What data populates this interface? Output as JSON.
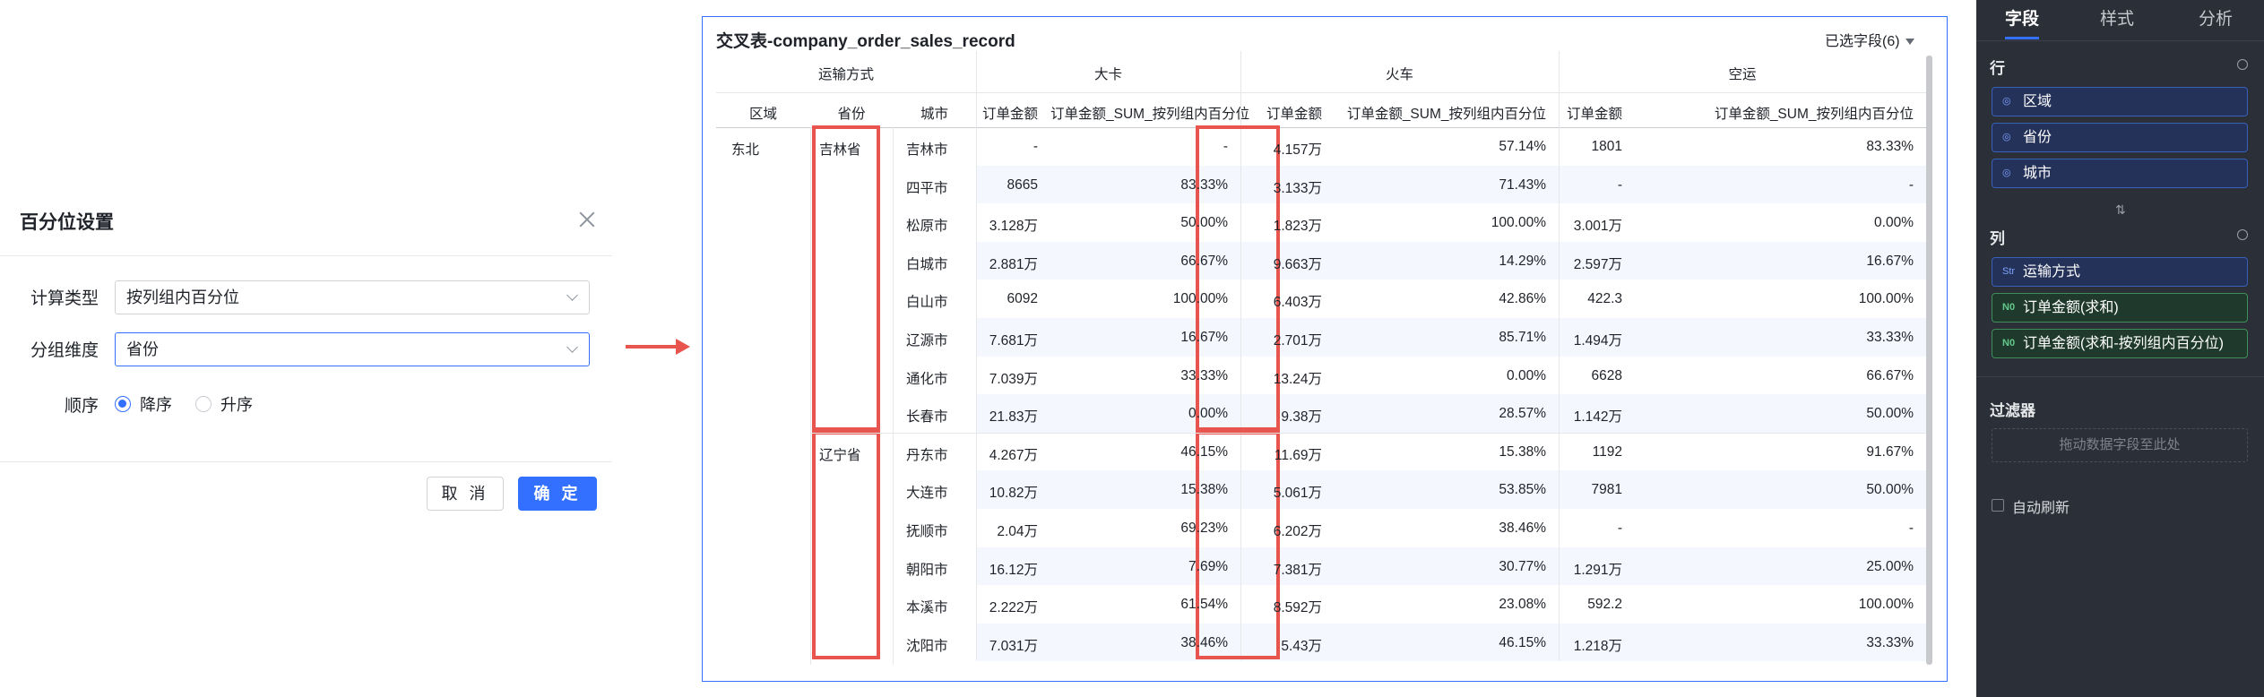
{
  "dialog": {
    "title": "百分位设置",
    "calc_type_label": "计算类型",
    "calc_type_value": "按列组内百分位",
    "group_dim_label": "分组维度",
    "group_dim_value": "省份",
    "order_label": "顺序",
    "order_desc": "降序",
    "order_asc": "升序",
    "cancel": "取 消",
    "ok": "确 定"
  },
  "table": {
    "title": "交叉表-company_order_sales_record",
    "fields_selected": "已选字段(6)",
    "col_dim_header": "运输方式",
    "groups": [
      "大卡",
      "火车",
      "空运"
    ],
    "row_headers": [
      "区域",
      "省份",
      "城市"
    ],
    "measure_a": "订单金额",
    "measure_b": "订单金额_SUM_按列组内百分位",
    "region": "东北",
    "provinces": [
      {
        "name": "吉林省",
        "rows": [
          {
            "city": "吉林市",
            "v": [
              "-",
              "-",
              "4.157万",
              "57.14%",
              "1801",
              "83.33%"
            ]
          },
          {
            "city": "四平市",
            "v": [
              "8665",
              "83.33%",
              "3.133万",
              "71.43%",
              "-",
              "-"
            ]
          },
          {
            "city": "松原市",
            "v": [
              "3.128万",
              "50.00%",
              "1.823万",
              "100.00%",
              "3.001万",
              "0.00%"
            ]
          },
          {
            "city": "白城市",
            "v": [
              "2.881万",
              "66.67%",
              "9.663万",
              "14.29%",
              "2.597万",
              "16.67%"
            ]
          },
          {
            "city": "白山市",
            "v": [
              "6092",
              "100.00%",
              "6.403万",
              "42.86%",
              "422.3",
              "100.00%"
            ]
          },
          {
            "city": "辽源市",
            "v": [
              "7.681万",
              "16.67%",
              "2.701万",
              "85.71%",
              "1.494万",
              "33.33%"
            ]
          },
          {
            "city": "通化市",
            "v": [
              "7.039万",
              "33.33%",
              "13.24万",
              "0.00%",
              "6628",
              "66.67%"
            ]
          },
          {
            "city": "长春市",
            "v": [
              "21.83万",
              "0.00%",
              "9.38万",
              "28.57%",
              "1.142万",
              "50.00%"
            ]
          }
        ]
      },
      {
        "name": "辽宁省",
        "rows": [
          {
            "city": "丹东市",
            "v": [
              "4.267万",
              "46.15%",
              "11.69万",
              "15.38%",
              "1192",
              "91.67%"
            ]
          },
          {
            "city": "大连市",
            "v": [
              "10.82万",
              "15.38%",
              "5.061万",
              "53.85%",
              "7981",
              "50.00%"
            ]
          },
          {
            "city": "抚顺市",
            "v": [
              "2.04万",
              "69.23%",
              "6.202万",
              "38.46%",
              "-",
              "-"
            ]
          },
          {
            "city": "朝阳市",
            "v": [
              "16.12万",
              "7.69%",
              "7.381万",
              "30.77%",
              "1.291万",
              "25.00%"
            ]
          },
          {
            "city": "本溪市",
            "v": [
              "2.222万",
              "61.54%",
              "8.592万",
              "23.08%",
              "592.2",
              "100.00%"
            ]
          },
          {
            "city": "沈阳市",
            "v": [
              "7.031万",
              "38.46%",
              "5.43万",
              "46.15%",
              "1.218万",
              "33.33%"
            ]
          }
        ]
      }
    ]
  },
  "right_panel": {
    "tabs": [
      "字段",
      "样式",
      "分析"
    ],
    "rows_label": "行",
    "rows": [
      "区域",
      "省份",
      "城市"
    ],
    "cols_label": "列",
    "col_dim": "运输方式",
    "col_measures": [
      "订单金额(求和)",
      "订单金额(求和-按列组内百分位)"
    ],
    "measure_icon": "N0",
    "dim_icon": "Str",
    "filter_label": "过滤器",
    "filter_placeholder": "拖动数据字段至此处",
    "auto_refresh": "自动刷新",
    "swap_glyph": "⇅"
  },
  "colors": {
    "accent": "#3370ff",
    "highlight": "#e8554e",
    "panel_bg": "#2b2f38"
  }
}
